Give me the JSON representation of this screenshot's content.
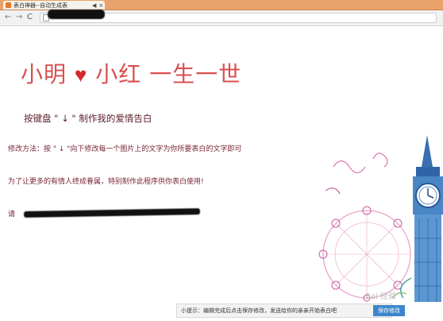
{
  "browser": {
    "tab_title": "表白神器--自动生成表",
    "tab_sound_icon": "◀",
    "tab_close": "×",
    "nav_back": "←",
    "nav_forward": "→",
    "nav_reload": "C"
  },
  "page": {
    "headline_left": "小明",
    "heart": "♥",
    "headline_right": "小红 一生一世",
    "subtitle": "按键盘 \" ↓ \" 制作我的爱情告白",
    "instructions": "修改方法：按 \" ↓ \"向下修改每一个图片上的文字为你所要表白的文字即可",
    "purpose": "为了让更多的有情人终成眷属，特别制作此程序供你表白使用!",
    "share_prefix": "请"
  },
  "hint_bar": {
    "text": "小提示：编辑完成后点击保存修改，发送给你的亲亲开始表白吧",
    "save_label": "保存修改"
  },
  "watermark": "Bai 经验",
  "colors": {
    "headline": "#d94f4f",
    "heart": "#d62a2a",
    "body_text": "#7a2438",
    "save_button": "#3d86c9",
    "tab_bar": "#e9a36a"
  }
}
